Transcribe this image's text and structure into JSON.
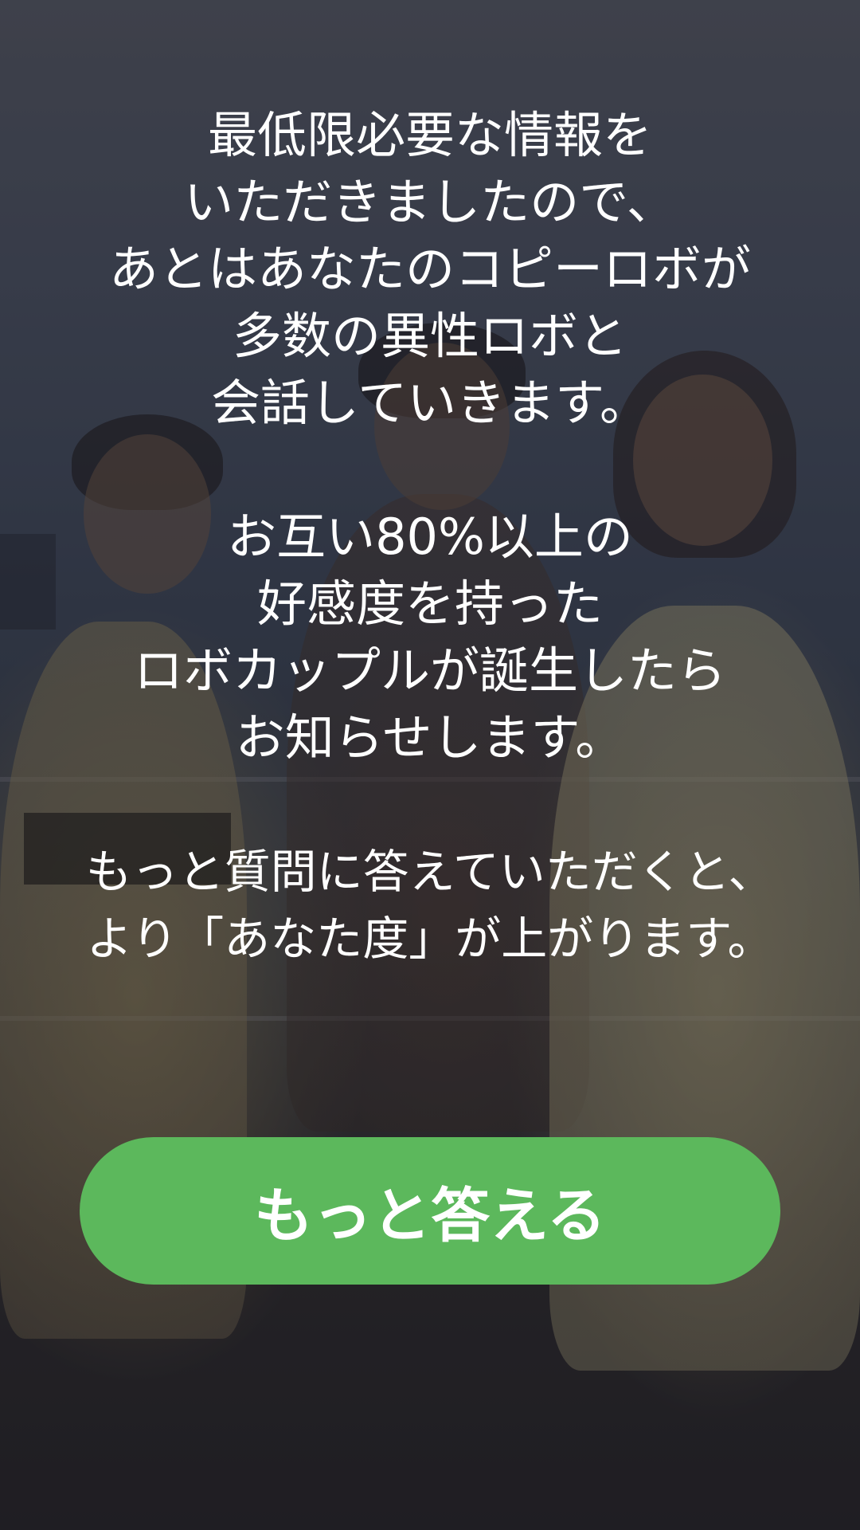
{
  "background": {
    "image": "couple-party-photo",
    "overlay_color": "#14141c"
  },
  "message": {
    "paragraph1": [
      "最低限必要な情報を",
      "いただきましたので、",
      "あとはあなたのコピーロボが",
      "多数の異性ロボと",
      "会話していきます。"
    ],
    "paragraph2": [
      "お互い80%以上の",
      "好感度を持った",
      "ロボカップルが誕生したら",
      "お知らせします。"
    ],
    "paragraph3": [
      "もっと質問に答えていただくと、",
      "より「あなた度」が上がります。"
    ]
  },
  "cta": {
    "label": "もっと答える",
    "color": "#5cb85c"
  }
}
